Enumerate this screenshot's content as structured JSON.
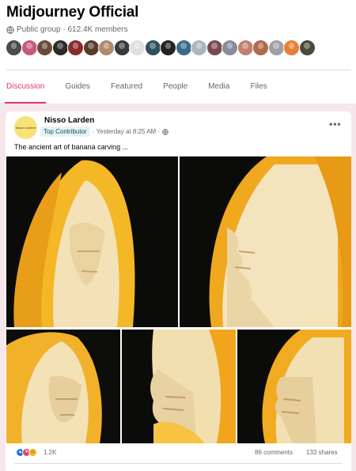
{
  "group": {
    "title": "Midjourney Official",
    "meta": "Public group · 612.4K members",
    "globe_icon": "globe-icon"
  },
  "member_avatar_colors": [
    "#4b4b4b",
    "#c85a78",
    "#6a4a3a",
    "#2a2a2a",
    "#8a2b2b",
    "#5a3a2a",
    "#b08a6a",
    "#3a3a3a",
    "#e0e0e0",
    "#2f4f5f",
    "#222222",
    "#3a6a8a",
    "#a9b7c0",
    "#7a4a4a",
    "#8a8a9a",
    "#c0806a",
    "#b06a4a",
    "#a0a0a0",
    "#e77e3a",
    "#4a4a3a"
  ],
  "tabs": [
    {
      "label": "Discussion",
      "active": true
    },
    {
      "label": "Guides",
      "active": false
    },
    {
      "label": "Featured",
      "active": false
    },
    {
      "label": "People",
      "active": false
    },
    {
      "label": "Media",
      "active": false
    },
    {
      "label": "Files",
      "active": false
    }
  ],
  "accent_color": "#e4356a",
  "post": {
    "avatar_text": "Nisso Larden",
    "author": "Nisso Larden",
    "badge": "Top Contributor",
    "time": "· Yesterday at 8:25 AM ·",
    "more_icon": "more-options-icon",
    "text": "The ancient art of banana carving ...",
    "reactions": {
      "icons": [
        "like-icon",
        "love-icon",
        "haha-icon"
      ],
      "count": "1.2K",
      "comments": "86 comments",
      "shares": "133 shares"
    }
  }
}
